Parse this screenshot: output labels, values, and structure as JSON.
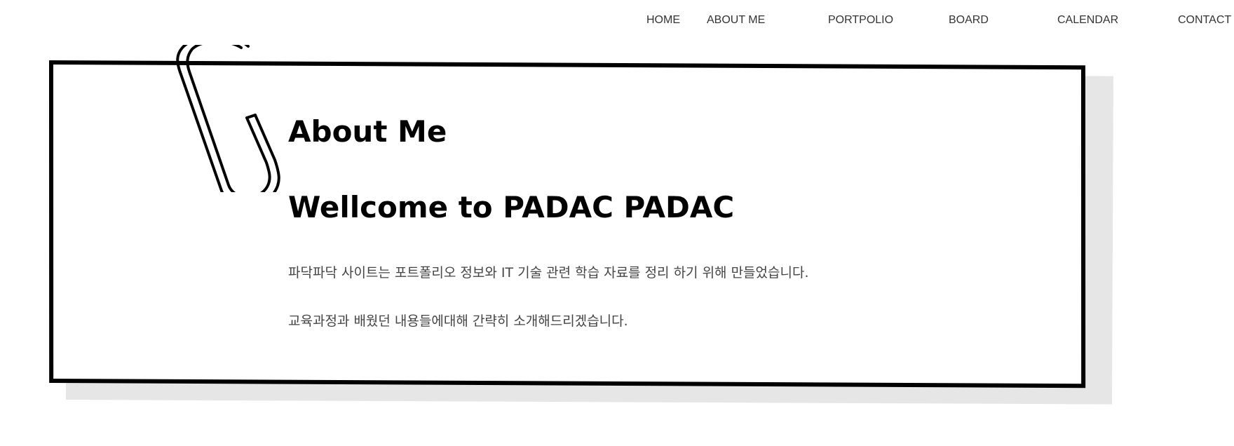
{
  "nav": {
    "items": [
      {
        "label": "HOME"
      },
      {
        "label": "ABOUT ME"
      },
      {
        "label": "PORTPOLIO"
      },
      {
        "label": "BOARD"
      },
      {
        "label": "CALENDAR"
      },
      {
        "label": "CONTACT"
      }
    ]
  },
  "main": {
    "title": "About Me",
    "welcome": "Wellcome to PADAC PADAC",
    "paragraphs": [
      "파닥파닥 사이트는 포트폴리오 정보와 IT 기술 관련 학습 자료를 정리 하기 위해 만들었습니다.",
      "교육과정과 배웠던 내용들에대해 간략히 소개해드리겠습니다."
    ]
  },
  "icons": {
    "paperclip": "paperclip-icon"
  },
  "colors": {
    "border": "#000000",
    "shadow": "#e6e6e6",
    "nav_text": "#333333",
    "body_text": "#444444"
  }
}
